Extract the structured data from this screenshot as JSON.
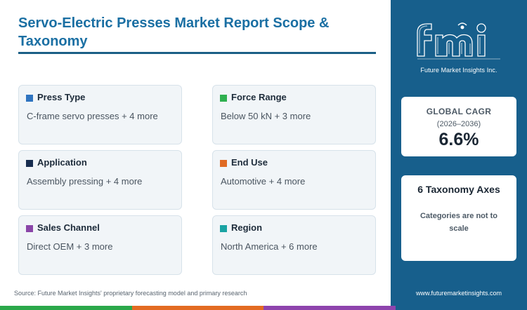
{
  "title": "Servo-Electric Presses Market Report Scope & Taxonomy",
  "cards": [
    {
      "label": "Press Type",
      "value": "C-frame servo presses + 4 more",
      "color": "#2f74c0"
    },
    {
      "label": "Force Range",
      "value": "Below 50 kN + 3 more",
      "color": "#2fb050"
    },
    {
      "label": "Application",
      "value": "Assembly pressing + 4 more",
      "color": "#172c4f"
    },
    {
      "label": "End Use",
      "value": "Automotive + 4 more",
      "color": "#e06a23"
    },
    {
      "label": "Sales Channel",
      "value": "Direct OEM + 3 more",
      "color": "#8a45a8"
    },
    {
      "label": "Region",
      "value": "North America + 6 more",
      "color": "#1aa3a3"
    }
  ],
  "source": "Source: Future Market Insights' proprietary forecasting model and primary research",
  "sidebar": {
    "logo_text": "fmi",
    "logo_tagline": "Future Market Insights Inc.",
    "cagr_label": "GLOBAL CAGR",
    "cagr_period": "(2026–2036)",
    "cagr_value": "6.6%",
    "axes_title": "6 Taxonomy Axes",
    "axes_note": "Categories are not to scale",
    "website": "www.futuremarketinsights.com"
  },
  "bottom_bar_colors": [
    "#2aa84a",
    "#e36b22",
    "#8e44ad",
    "#175f8c"
  ]
}
